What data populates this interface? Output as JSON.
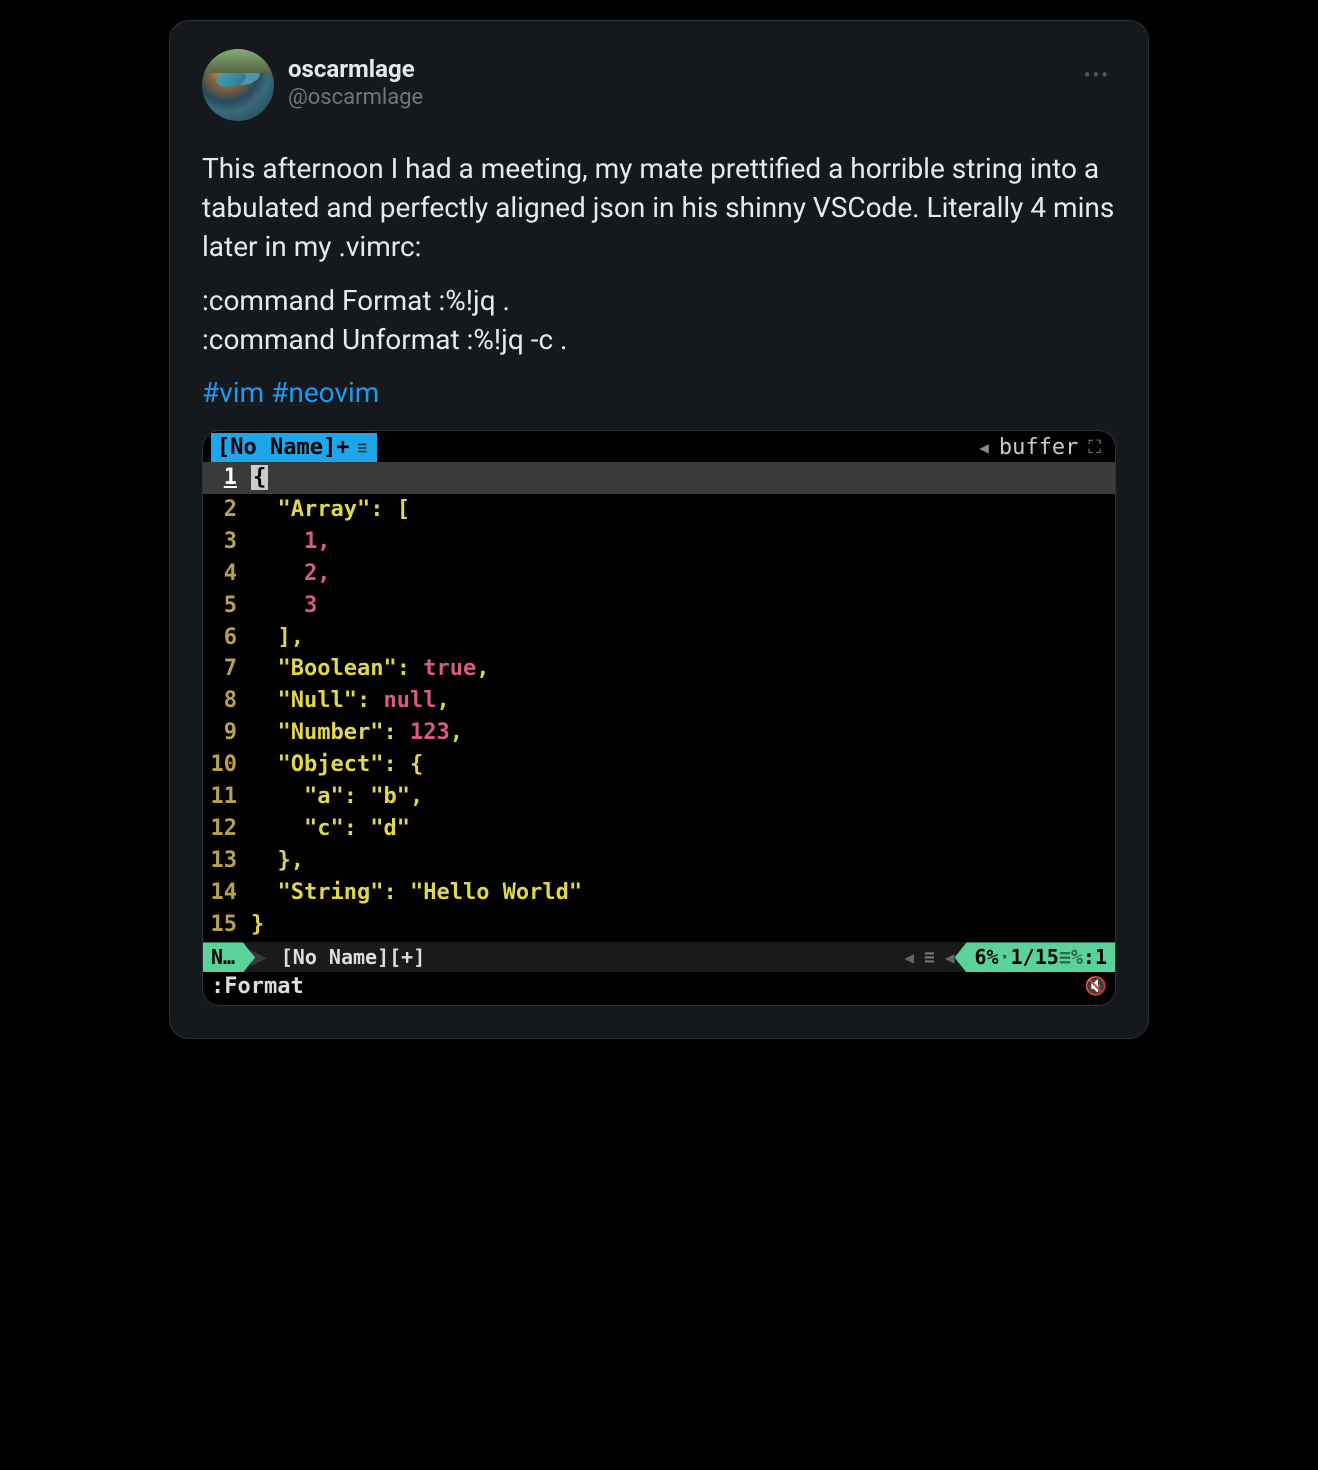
{
  "tweet": {
    "author": {
      "display_name": "oscarmlage",
      "handle": "@oscarmlage"
    },
    "body": {
      "p1": "This afternoon I had a meeting, my mate prettified a horrible string into a tabulated and perfectly aligned json in his shinny VSCode. Literally 4 mins later in my .vimrc:",
      "p2a": ":command Format :%!jq .",
      "p2b": ":command Unformat :%!jq -c .",
      "hashtag1": "#vim",
      "hashtag2": "#neovim"
    }
  },
  "terminal": {
    "tab_label": "[No Name]+",
    "top_right_label": "buffer",
    "lines": {
      "l1": "{",
      "l2_key": "\"Array\"",
      "l2_rest": ": [",
      "l3": "1,",
      "l4": "2,",
      "l5": "3",
      "l6": "],",
      "l7_key": "\"Boolean\"",
      "l7_val": "true",
      "l7_comma": ",",
      "l8_key": "\"Null\"",
      "l8_val": "null",
      "l8_comma": ",",
      "l9_key": "\"Number\"",
      "l9_val": "123",
      "l9_comma": ",",
      "l10_key": "\"Object\"",
      "l10_rest": ": {",
      "l11_key": "\"a\"",
      "l11_val": "\"b\"",
      "l11_comma": ",",
      "l12_key": "\"c\"",
      "l12_val": "\"d\"",
      "l13": "},",
      "l14_key": "\"String\"",
      "l14_val": "\"Hello World\"",
      "l15": "}"
    },
    "linenums": {
      "n1": "1",
      "n2": "2",
      "n3": "3",
      "n4": "4",
      "n5": "5",
      "n6": "6",
      "n7": "7",
      "n8": "8",
      "n9": "9",
      "n10": "10",
      "n11": "11",
      "n12": "12",
      "n13": "13",
      "n14": "14",
      "n15": "15"
    },
    "statusline": {
      "mode": "N…",
      "filename": "[No Name][+]",
      "position_pct": "6%",
      "position_line": "1/15",
      "position_col": ":1"
    },
    "cmdline": ":Format"
  }
}
